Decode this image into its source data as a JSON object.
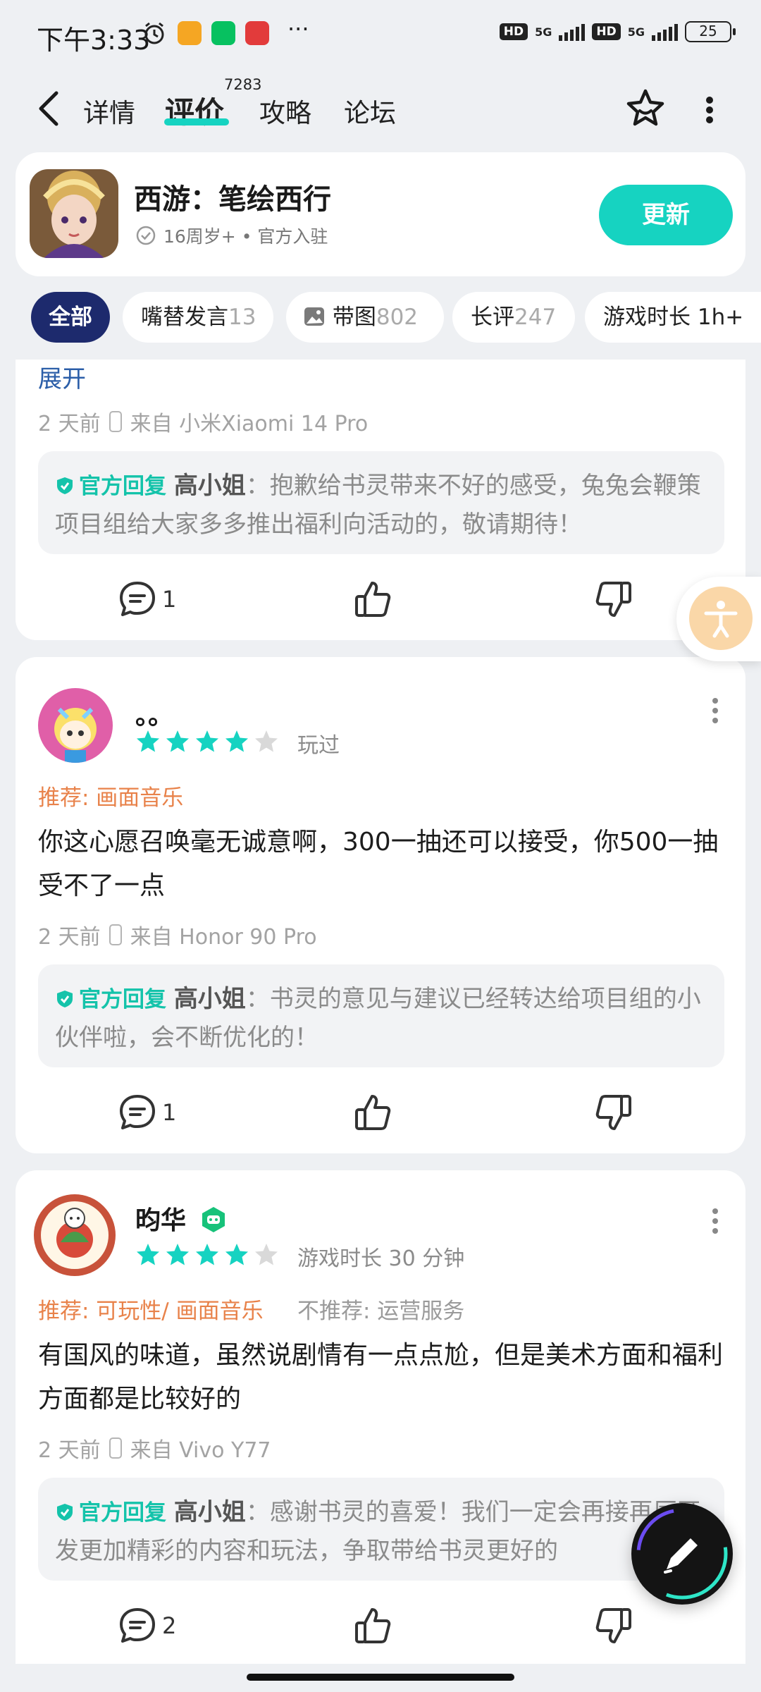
{
  "status_bar": {
    "time": "下午3:33",
    "dots": "···",
    "net1": "5G",
    "net2": "5G",
    "hd": "HD",
    "battery": "25"
  },
  "nav": {
    "tabs": [
      "详情",
      "评价",
      "攻略",
      "论坛"
    ],
    "active_tab": "评价",
    "review_count": "7283"
  },
  "game": {
    "title": "西游：笔绘西行",
    "meta": "16周岁+ • 官方入驻",
    "update_label": "更新"
  },
  "filters": [
    {
      "label": "全部",
      "count": ""
    },
    {
      "label": "嘴替发言",
      "count": "13"
    },
    {
      "label": "带图",
      "count": "802"
    },
    {
      "label": "长评",
      "count": "247"
    },
    {
      "label": "游戏时长 1h+",
      "count": ""
    }
  ],
  "reviews": [
    {
      "expand": "展开",
      "time": "2 天前",
      "device": "来自 小米Xiaomi 14 Pro",
      "reply_tag": "官方回复",
      "replier": "高小姐",
      "reply": "：抱歉给书灵带来不好的感受，兔兔会鞭策项目组给大家多多推出福利向活动的，敬请期待！",
      "comments": "1"
    },
    {
      "name": "。。",
      "rating": 4,
      "played": "玩过",
      "recommend": "推荐: 画面音乐",
      "text": "你这心愿召唤毫无诚意啊，300一抽还可以接受，你500一抽受不了一点",
      "time": "2 天前",
      "device": "来自 Honor 90 Pro",
      "reply_tag": "官方回复",
      "replier": "高小姐",
      "reply": "：书灵的意见与建议已经转达给项目组的小伙伴啦，会不断优化的！",
      "comments": "1"
    },
    {
      "name": "昀华",
      "rating": 4,
      "played": "游戏时长 30 分钟",
      "recommend": "推荐: 可玩性/ 画面音乐",
      "not_recommend": "不推荐: 运营服务",
      "text": "有国风的味道，虽然说剧情有一点点尬，但是美术方面和福利方面都是比较好的",
      "time": "2 天前",
      "device": "来自 Vivo Y77",
      "reply_tag": "官方回复",
      "replier": "高小姐",
      "reply": "：感谢书灵的喜爱！我们一定会再接再厉开发更加精彩的内容和玩法，争取带给书灵更好的",
      "comments": "2"
    }
  ],
  "colors": {
    "accent": "#16d3c1",
    "chip_active": "#1d2a6d",
    "recommend": "#e8824a",
    "official": "#14c3aa"
  }
}
